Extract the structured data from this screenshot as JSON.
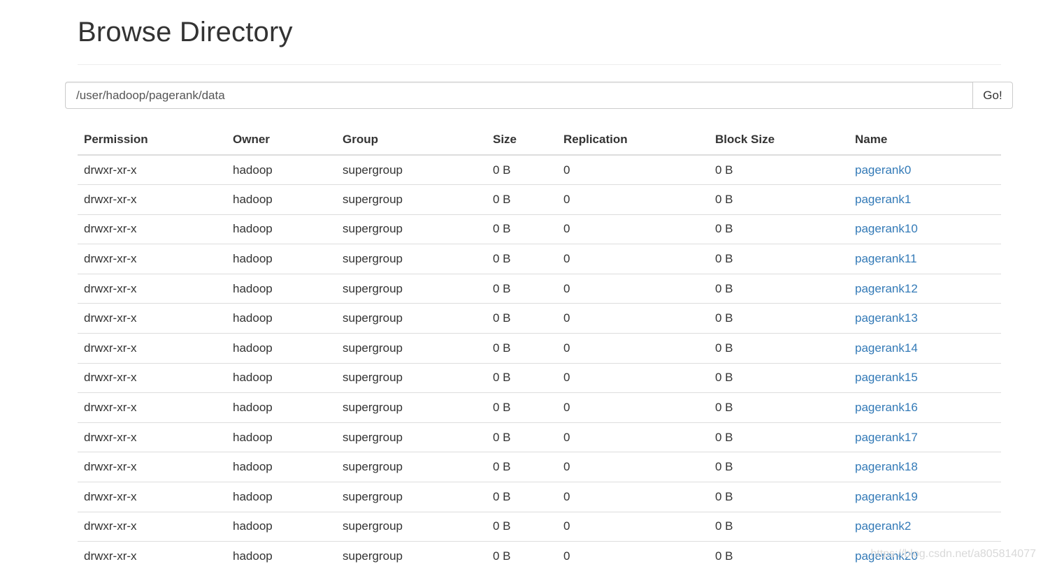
{
  "page": {
    "title": "Browse Directory"
  },
  "path_bar": {
    "value": "/user/hadoop/pagerank/data",
    "go_label": "Go!"
  },
  "table": {
    "headers": [
      "Permission",
      "Owner",
      "Group",
      "Size",
      "Replication",
      "Block Size",
      "Name"
    ],
    "rows": [
      {
        "permission": "drwxr-xr-x",
        "owner": "hadoop",
        "group": "supergroup",
        "size": "0 B",
        "replication": "0",
        "block_size": "0 B",
        "name": "pagerank0"
      },
      {
        "permission": "drwxr-xr-x",
        "owner": "hadoop",
        "group": "supergroup",
        "size": "0 B",
        "replication": "0",
        "block_size": "0 B",
        "name": "pagerank1"
      },
      {
        "permission": "drwxr-xr-x",
        "owner": "hadoop",
        "group": "supergroup",
        "size": "0 B",
        "replication": "0",
        "block_size": "0 B",
        "name": "pagerank10"
      },
      {
        "permission": "drwxr-xr-x",
        "owner": "hadoop",
        "group": "supergroup",
        "size": "0 B",
        "replication": "0",
        "block_size": "0 B",
        "name": "pagerank11"
      },
      {
        "permission": "drwxr-xr-x",
        "owner": "hadoop",
        "group": "supergroup",
        "size": "0 B",
        "replication": "0",
        "block_size": "0 B",
        "name": "pagerank12"
      },
      {
        "permission": "drwxr-xr-x",
        "owner": "hadoop",
        "group": "supergroup",
        "size": "0 B",
        "replication": "0",
        "block_size": "0 B",
        "name": "pagerank13"
      },
      {
        "permission": "drwxr-xr-x",
        "owner": "hadoop",
        "group": "supergroup",
        "size": "0 B",
        "replication": "0",
        "block_size": "0 B",
        "name": "pagerank14"
      },
      {
        "permission": "drwxr-xr-x",
        "owner": "hadoop",
        "group": "supergroup",
        "size": "0 B",
        "replication": "0",
        "block_size": "0 B",
        "name": "pagerank15"
      },
      {
        "permission": "drwxr-xr-x",
        "owner": "hadoop",
        "group": "supergroup",
        "size": "0 B",
        "replication": "0",
        "block_size": "0 B",
        "name": "pagerank16"
      },
      {
        "permission": "drwxr-xr-x",
        "owner": "hadoop",
        "group": "supergroup",
        "size": "0 B",
        "replication": "0",
        "block_size": "0 B",
        "name": "pagerank17"
      },
      {
        "permission": "drwxr-xr-x",
        "owner": "hadoop",
        "group": "supergroup",
        "size": "0 B",
        "replication": "0",
        "block_size": "0 B",
        "name": "pagerank18"
      },
      {
        "permission": "drwxr-xr-x",
        "owner": "hadoop",
        "group": "supergroup",
        "size": "0 B",
        "replication": "0",
        "block_size": "0 B",
        "name": "pagerank19"
      },
      {
        "permission": "drwxr-xr-x",
        "owner": "hadoop",
        "group": "supergroup",
        "size": "0 B",
        "replication": "0",
        "block_size": "0 B",
        "name": "pagerank2"
      },
      {
        "permission": "drwxr-xr-x",
        "owner": "hadoop",
        "group": "supergroup",
        "size": "0 B",
        "replication": "0",
        "block_size": "0 B",
        "name": "pagerank20"
      }
    ]
  },
  "watermark": "https://blog.csdn.net/a805814077",
  "colors": {
    "link": "#337ab7",
    "text": "#333333",
    "border": "#dddddd"
  }
}
